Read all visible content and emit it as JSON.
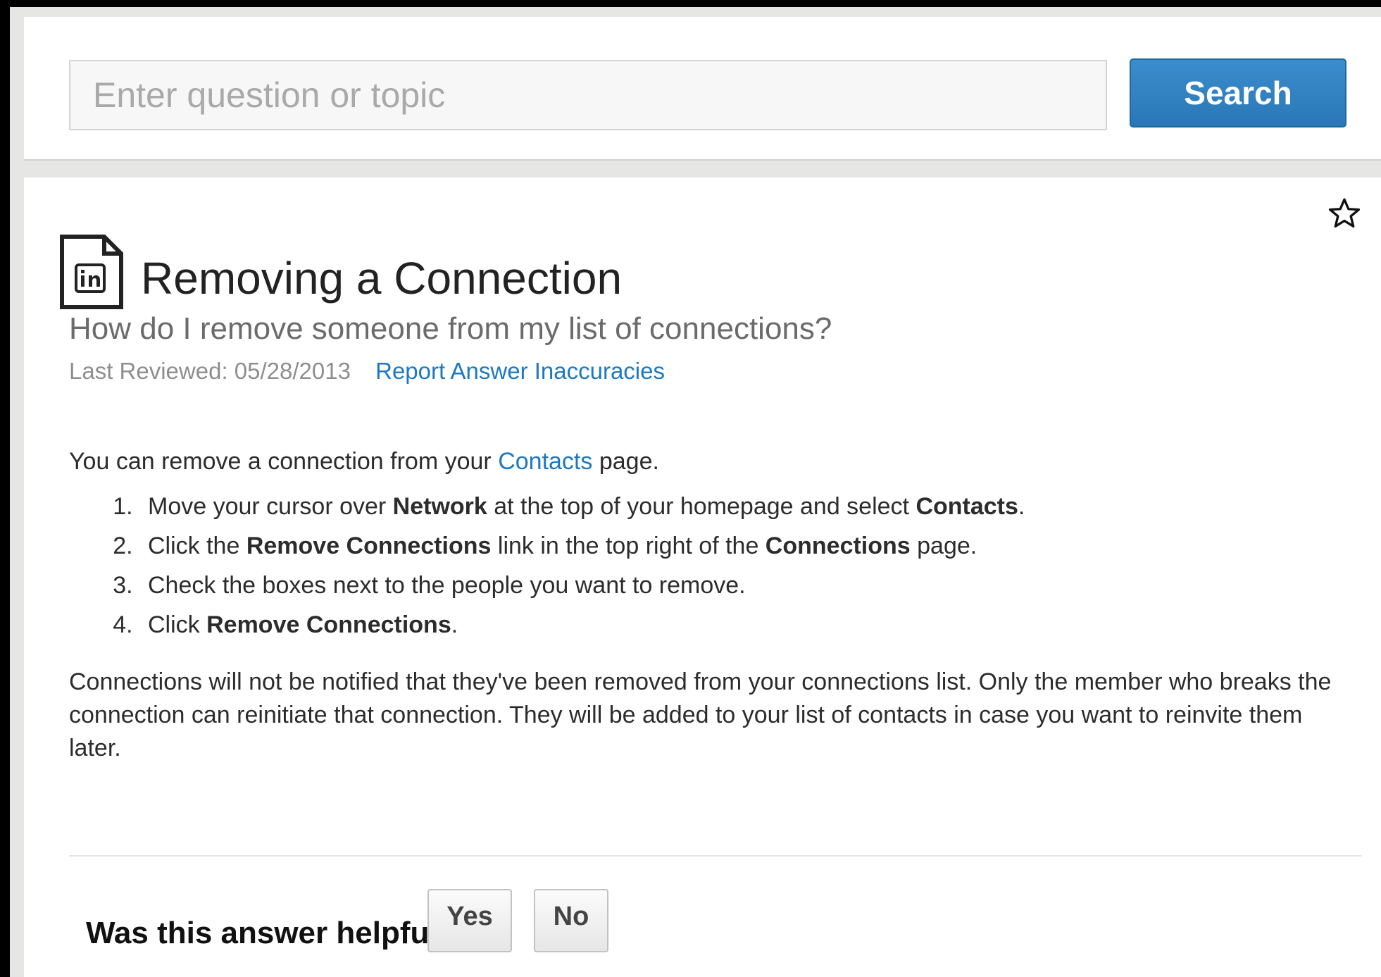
{
  "search": {
    "placeholder": "Enter question or topic",
    "button_label": "Search"
  },
  "article": {
    "icon": "linkedin-document-icon",
    "favorite_icon": "star-outline-icon",
    "title": "Removing a Connection",
    "subtitle": "How do I remove someone from my list of connections?",
    "last_reviewed": "Last Reviewed: 05/28/2013",
    "report_link": "Report Answer Inaccuracies",
    "intro": {
      "before": "You can remove a connection from your ",
      "link": "Contacts",
      "after": " page."
    },
    "steps": [
      {
        "t1": "Move your cursor over ",
        "b1": "Network",
        "t2": " at the top of your homepage and select ",
        "b2": "Contacts",
        "t3": "."
      },
      {
        "t1": "Click the ",
        "b1": "Remove Connections",
        "t2": " link in the top right of the ",
        "b2": "Connections",
        "t3": " page."
      },
      {
        "t1": "Check the boxes next to the people you want to remove."
      },
      {
        "t1": "Click ",
        "b1": "Remove Connections",
        "t2": "."
      }
    ],
    "note": "Connections will not be notified that they've been removed from your connections list. Only the member who breaks the connection can reinitiate that connection. They will be added to your list of contacts in case you want to reinvite them later."
  },
  "feedback": {
    "question": "Was this answer helpful?",
    "yes_label": "Yes",
    "no_label": "No"
  },
  "colors": {
    "primary_button": "#2a77b6",
    "link": "#1d78c1",
    "page_background": "#e6e6e4"
  }
}
